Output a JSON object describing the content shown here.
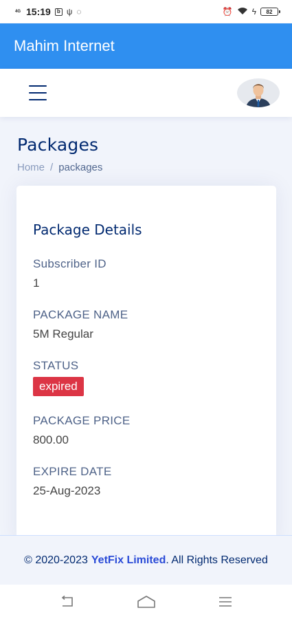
{
  "status_bar": {
    "network": "4G",
    "time": "15:19",
    "battery": "82",
    "icons": [
      "network-icon",
      "notification-icon",
      "usb-icon",
      "whatsapp-icon",
      "alarm-icon",
      "wifi-icon",
      "charging-icon",
      "battery-icon"
    ]
  },
  "app": {
    "title": "Mahim Internet"
  },
  "page": {
    "title": "Packages",
    "breadcrumb": {
      "home": "Home",
      "separator": "/",
      "current": "packages"
    }
  },
  "card": {
    "title": "Package Details",
    "fields": [
      {
        "label": "Subscriber ID",
        "value": "1"
      },
      {
        "label": "PACKAGE NAME",
        "value": "5M Regular"
      },
      {
        "label": "STATUS",
        "value": "expired",
        "badge_color": "#dc3545"
      },
      {
        "label": "PACKAGE PRICE",
        "value": "800.00"
      },
      {
        "label": "EXPIRE DATE",
        "value": "25-Aug-2023"
      }
    ]
  },
  "footer": {
    "copyright": "© 2020-2023",
    "brand": "YetFix Limited",
    "rest": ". All Rights Reserved"
  },
  "colors": {
    "app_bar": "#2f8ff0",
    "primary_text": "#012970",
    "badge_danger": "#dc3545",
    "brand_link": "#2a4bd7"
  }
}
